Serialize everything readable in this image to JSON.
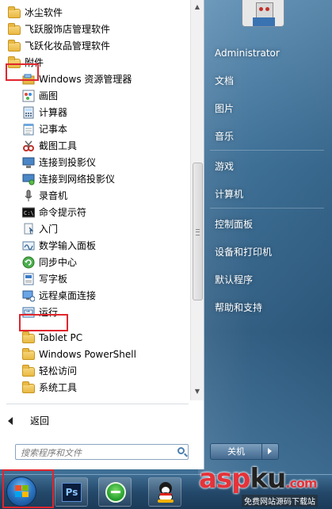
{
  "programs": {
    "items": [
      {
        "label": "冰尘软件",
        "icon": "folder-icon"
      },
      {
        "label": "飞跃服饰店管理软件",
        "icon": "folder-icon"
      },
      {
        "label": "飞跃化妆品管理软件",
        "icon": "folder-icon"
      },
      {
        "label": "附件",
        "icon": "folder-open-icon"
      },
      {
        "label": "Windows 资源管理器",
        "icon": "explorer-icon"
      },
      {
        "label": "画图",
        "icon": "paint-icon"
      },
      {
        "label": "计算器",
        "icon": "calculator-icon"
      },
      {
        "label": "记事本",
        "icon": "notepad-icon"
      },
      {
        "label": "截图工具",
        "icon": "snipping-tool-icon"
      },
      {
        "label": "连接到投影仪",
        "icon": "projector-icon"
      },
      {
        "label": "连接到网络投影仪",
        "icon": "network-projector-icon"
      },
      {
        "label": "录音机",
        "icon": "microphone-icon"
      },
      {
        "label": "命令提示符",
        "icon": "cmd-icon"
      },
      {
        "label": "入门",
        "icon": "getting-started-icon"
      },
      {
        "label": "数学输入面板",
        "icon": "math-input-icon"
      },
      {
        "label": "同步中心",
        "icon": "sync-icon"
      },
      {
        "label": "写字板",
        "icon": "wordpad-icon"
      },
      {
        "label": "远程桌面连接",
        "icon": "remote-desktop-icon"
      },
      {
        "label": "运行",
        "icon": "run-icon"
      },
      {
        "label": "Tablet PC",
        "icon": "folder-icon"
      },
      {
        "label": "Windows PowerShell",
        "icon": "folder-icon"
      },
      {
        "label": "轻松访问",
        "icon": "folder-icon"
      },
      {
        "label": "系统工具",
        "icon": "folder-icon"
      }
    ],
    "back_label": "返回",
    "search_placeholder": "搜索程序和文件"
  },
  "right_panel": {
    "user": "Administrator",
    "items": [
      "文档",
      "图片",
      "音乐",
      "游戏",
      "计算机",
      "控制面板",
      "设备和打印机",
      "默认程序",
      "帮助和支持"
    ],
    "shutdown_label": "关机"
  },
  "taskbar": {
    "apps": [
      "start-orb",
      "photoshop",
      "ie",
      "qq"
    ],
    "ps_text": "Ps"
  },
  "watermark": {
    "brand_a": "asp",
    "brand_b": "ku",
    "brand_c": ".com",
    "sub": "免费网站源码下载站"
  },
  "colors": {
    "highlight": "#e0262d",
    "folder": "#e9b844",
    "menu_glass": "#3a6c93"
  }
}
